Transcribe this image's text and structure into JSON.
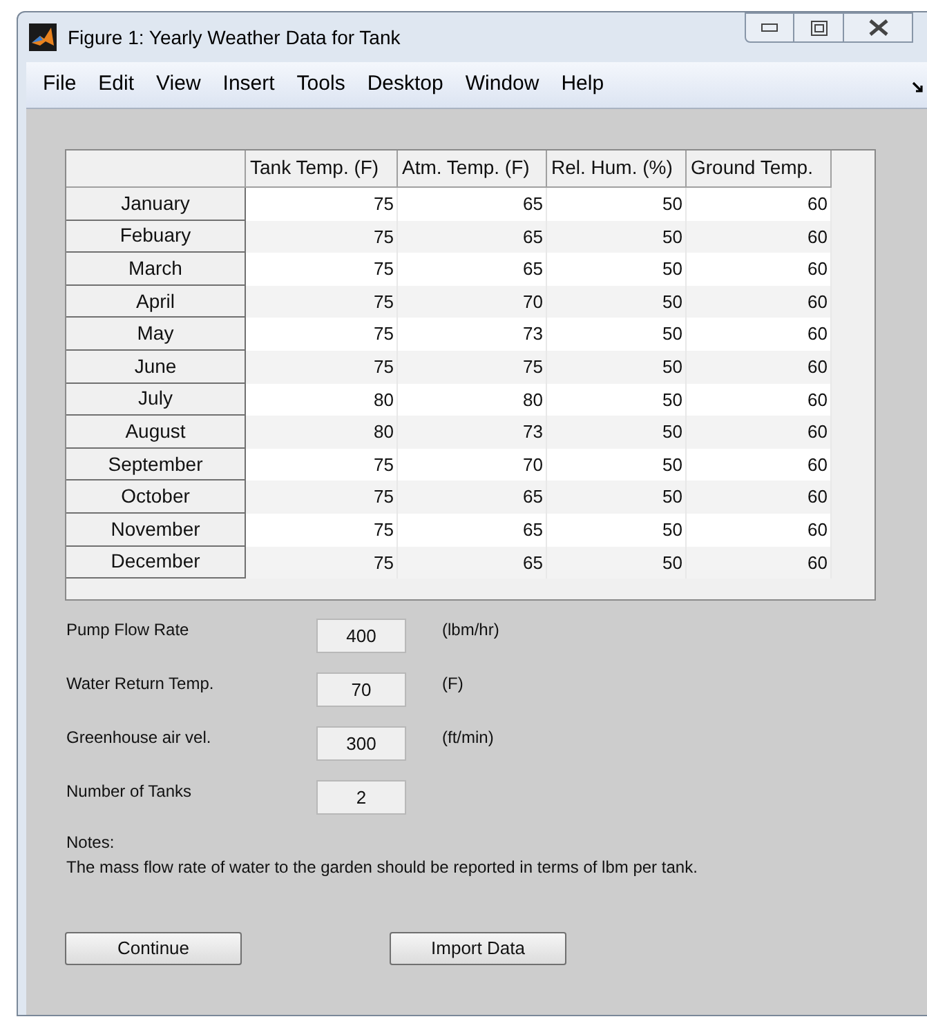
{
  "window": {
    "title": "Figure 1: Yearly Weather Data for Tank"
  },
  "menu": [
    "File",
    "Edit",
    "View",
    "Insert",
    "Tools",
    "Desktop",
    "Window",
    "Help"
  ],
  "table": {
    "columns": [
      "Tank Temp. (F)",
      "Atm. Temp. (F)",
      "Rel. Hum. (%)",
      "Ground Temp."
    ],
    "rows": [
      {
        "label": "January",
        "cells": [
          "75",
          "65",
          "50",
          "60"
        ]
      },
      {
        "label": "Febuary",
        "cells": [
          "75",
          "65",
          "50",
          "60"
        ]
      },
      {
        "label": "March",
        "cells": [
          "75",
          "65",
          "50",
          "60"
        ]
      },
      {
        "label": "April",
        "cells": [
          "75",
          "70",
          "50",
          "60"
        ]
      },
      {
        "label": "May",
        "cells": [
          "75",
          "73",
          "50",
          "60"
        ]
      },
      {
        "label": "June",
        "cells": [
          "75",
          "75",
          "50",
          "60"
        ]
      },
      {
        "label": "July",
        "cells": [
          "80",
          "80",
          "50",
          "60"
        ]
      },
      {
        "label": "August",
        "cells": [
          "80",
          "73",
          "50",
          "60"
        ]
      },
      {
        "label": "September",
        "cells": [
          "75",
          "70",
          "50",
          "60"
        ]
      },
      {
        "label": "October",
        "cells": [
          "75",
          "65",
          "50",
          "60"
        ]
      },
      {
        "label": "November",
        "cells": [
          "75",
          "65",
          "50",
          "60"
        ]
      },
      {
        "label": "December",
        "cells": [
          "75",
          "65",
          "50",
          "60"
        ]
      }
    ]
  },
  "fields": [
    {
      "label": "Pump Flow Rate",
      "value": "400",
      "unit": "(lbm/hr)"
    },
    {
      "label": "Water Return Temp.",
      "value": "70",
      "unit": "(F)"
    },
    {
      "label": "Greenhouse air vel.",
      "value": "300",
      "unit": "(ft/min)"
    },
    {
      "label": "Number of Tanks",
      "value": "2"
    }
  ],
  "notes": {
    "heading": "Notes:",
    "text": "The mass flow rate of water to the garden should be reported in terms of lbm per tank."
  },
  "buttons": [
    "Continue",
    "Import Data"
  ]
}
